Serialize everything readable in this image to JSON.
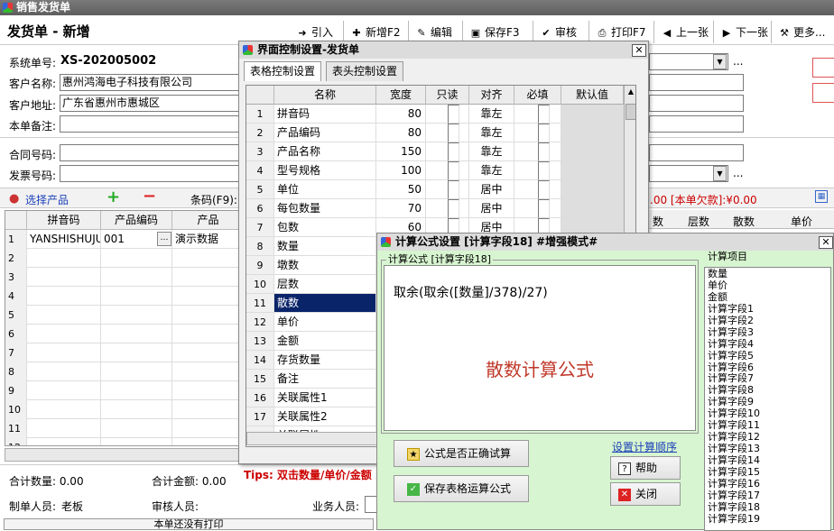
{
  "window": {
    "title": "销售发货单"
  },
  "page": {
    "title": "发货单 - 新增"
  },
  "toolbar": [
    {
      "label": "引入",
      "icon": "import-arrow-icon"
    },
    {
      "label": "新增F2",
      "icon": "new-doc-icon"
    },
    {
      "label": "编辑",
      "icon": "edit-icon"
    },
    {
      "label": "保存F3",
      "icon": "save-disk-icon"
    },
    {
      "label": "审核",
      "icon": "checkmark-icon"
    },
    {
      "label": "打印F7",
      "icon": "printer-icon"
    },
    {
      "label": "上一张",
      "icon": "arrow-left-icon"
    },
    {
      "label": "下一张",
      "icon": "arrow-right-icon"
    },
    {
      "label": "更多...",
      "icon": "tools-icon"
    }
  ],
  "form": {
    "order_no_label": "系统单号:",
    "order_no": "XS-202005002",
    "customer_name_label": "客户名称:",
    "customer_name": "惠州鸿海电子科技有限公司",
    "customer_address_label": "客户地址:",
    "customer_address": "广东省惠州市惠城区",
    "remark_label": "本单备注:",
    "contract_no_label": "合同号码:",
    "invoice_no_label": "发票号码:",
    "ellipsis": "..."
  },
  "product_bar": {
    "select_product": "选择产品",
    "barcode_label": "条码(F9):",
    "arrears_text": ".00 [本单欠款]:¥0.00"
  },
  "main_grid": {
    "headers": [
      "拼音码",
      "产品编码",
      "产品"
    ],
    "right_headers": [
      "数",
      "层数",
      "散数",
      "单价"
    ],
    "rows": [
      {
        "num": "1",
        "pinyin": "YANSHISHUJU",
        "code": "001",
        "name": "演示数据"
      },
      {
        "num": "2"
      },
      {
        "num": "3"
      },
      {
        "num": "4"
      },
      {
        "num": "5"
      },
      {
        "num": "6"
      },
      {
        "num": "7"
      },
      {
        "num": "8"
      },
      {
        "num": "9"
      },
      {
        "num": "10"
      },
      {
        "num": "11"
      },
      {
        "num": "12"
      }
    ]
  },
  "footer": {
    "total_qty": "合计数量: 0.00",
    "total_amount": "合计金额: 0.00",
    "tips": "Tips: 双击数量/单价/金额",
    "maker_label": "制单人员:",
    "maker": "老板",
    "auditor_label": "审核人员:",
    "sales_label": "业务人员:",
    "print_status": "本单还没有打印"
  },
  "ui_dialog": {
    "title": "界面控制设置-发货单",
    "tabs": [
      "表格控制设置",
      "表头控制设置"
    ],
    "headers": [
      "名称",
      "宽度",
      "只读",
      "对齐",
      "必填",
      "默认值"
    ],
    "rows": [
      {
        "n": "1",
        "name": "拼音码",
        "width": "80",
        "align": "靠左"
      },
      {
        "n": "2",
        "name": "产品编码",
        "width": "80",
        "align": "靠左"
      },
      {
        "n": "3",
        "name": "产品名称",
        "width": "150",
        "align": "靠左"
      },
      {
        "n": "4",
        "name": "型号规格",
        "width": "100",
        "align": "靠左"
      },
      {
        "n": "5",
        "name": "单位",
        "width": "50",
        "align": "居中"
      },
      {
        "n": "6",
        "name": "每包数量",
        "width": "70",
        "align": "居中"
      },
      {
        "n": "7",
        "name": "包数",
        "width": "60",
        "align": "居中"
      },
      {
        "n": "8",
        "name": "数量",
        "width": "",
        "align": ""
      },
      {
        "n": "9",
        "name": "墩数",
        "width": "",
        "align": ""
      },
      {
        "n": "10",
        "name": "层数",
        "width": "",
        "align": ""
      },
      {
        "n": "11",
        "name": "散数",
        "width": "",
        "align": ""
      },
      {
        "n": "12",
        "name": "单价",
        "width": "",
        "align": ""
      },
      {
        "n": "13",
        "name": "金额",
        "width": "",
        "align": ""
      },
      {
        "n": "14",
        "name": "存货数量",
        "width": "",
        "align": ""
      },
      {
        "n": "15",
        "name": "备注",
        "width": "",
        "align": ""
      },
      {
        "n": "16",
        "name": "关联属性1",
        "width": "",
        "align": ""
      },
      {
        "n": "17",
        "name": "关联属性2",
        "width": "",
        "align": ""
      },
      {
        "n": "18",
        "name": "关联属性",
        "width": "",
        "align": ""
      }
    ],
    "selected_row": 10
  },
  "formula_dialog": {
    "title": "计算公式设置 [计算字段18]  #增强模式#",
    "group_formula": "计算公式 [计算字段18]",
    "formula": "取余(取余([数量]/378)/27)",
    "watermark": "散数计算公式",
    "group_items": "计算项目",
    "items": [
      "数量",
      "单价",
      "金额",
      "计算字段1",
      "计算字段2",
      "计算字段3",
      "计算字段4",
      "计算字段5",
      "计算字段6",
      "计算字段7",
      "计算字段8",
      "计算字段9",
      "计算字段10",
      "计算字段11",
      "计算字段12",
      "计算字段13",
      "计算字段14",
      "计算字段15",
      "计算字段16",
      "计算字段17",
      "计算字段18",
      "计算字段19"
    ],
    "test_button": "公式是否正确试算",
    "save_button": "保存表格运算公式",
    "order_link": "设置计算顺序",
    "help_button": "帮助",
    "close_button": "关闭",
    "watermark_color": "#c0392b",
    "link_color": "#1a3fb8"
  },
  "colors": {
    "tips": "#cc0000",
    "select_blue": "#0a246a",
    "dialog_green": "#d7f5d0"
  }
}
